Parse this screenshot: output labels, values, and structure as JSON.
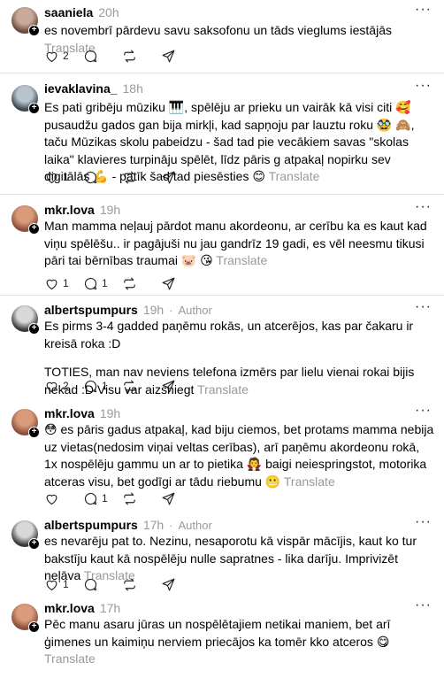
{
  "translate_label": "Translate",
  "author_label": "Author",
  "posts": [
    {
      "username": "saaniela",
      "time": "20h",
      "is_author": false,
      "paragraphs": [
        "es novembrī pārdevu savu saksofonu un tāds vieglums iestājās"
      ],
      "likes": "2",
      "replies": ""
    },
    {
      "username": "ievaklavina_",
      "time": "18h",
      "is_author": false,
      "paragraphs": [
        "Es pati gribēju mūziku 🎹, spēlēju ar prieku un vairāk kā visi citi 🥰 pusaudžu gados gan bija mirkļi, kad sapņoju par lauztu roku 🥸 🙈, taču Mūzikas skolu pabeidzu - šad tad pie vecākiem savas \"skolas laika\" klavieres turpināju spēlēt, līdz pāris g atpakaļ nopirku sev digitālās 💪 - patīk šad tad piesēsties 😊"
      ],
      "likes": "1",
      "replies": ""
    },
    {
      "username": "mkr.lova",
      "time": "19h",
      "is_author": false,
      "paragraphs": [
        "Man mamma neļauj pārdot manu akordeonu, ar cerību ka es kaut kad viņu spēlēšu.. ir pagājuši nu jau gandrīz 19 gadi, es vēl neesmu tikusi pāri tai bērnības traumai 🐷 😘"
      ],
      "likes": "1",
      "replies": "1"
    },
    {
      "username": "albertspumpurs",
      "time": "19h",
      "is_author": true,
      "paragraphs": [
        "Es pirms 3-4 gadded paņēmu rokās, un atcerējos, kas par čakaru ir kreisā roka :D",
        "TOTIES, man nav neviens telefona izmērs par lielu vienai rokai bijis nekad :D Visu var aizsniegt"
      ],
      "likes": "2",
      "replies": "1"
    },
    {
      "username": "mkr.lova",
      "time": "19h",
      "is_author": false,
      "paragraphs": [
        "😳 es pāris gadus atpakaļ, kad biju ciemos, bet protams mamma nebija uz vietas(nedosim viņai veltas cerības), arī paņēmu akordeonu rokā, 1x nospēlēju gammu un ar to pietika 🧛 baigi neiespringstot, motorika atceras visu, bet godīgi ar tādu riebumu 😬"
      ],
      "likes": "",
      "replies": "1"
    },
    {
      "username": "albertspumpurs",
      "time": "17h",
      "is_author": true,
      "paragraphs": [
        "es nevarēju pat to. Nezinu, nesaporotu kā vispār mācījis, kaut ko tur bakstīju kaut kā nospēlēju nulle sapratnes - lika darīju. Imprivizēt neļāva"
      ],
      "likes": "1",
      "replies": ""
    },
    {
      "username": "mkr.lova",
      "time": "17h",
      "is_author": false,
      "paragraphs": [
        "Pēc manu asaru jūras un nospēlētajiem netikai maniem, bet arī ģimenes un kaimiņu nerviem priecājos ka tomēr kko atceros 😋"
      ],
      "likes": "",
      "replies": ""
    }
  ],
  "colors": {
    "muted": "#999999",
    "divider": "#e2e2e2",
    "text": "#000000"
  },
  "icons": {
    "like": "heart-icon",
    "reply": "comment-icon",
    "repost": "repost-icon",
    "share": "send-icon",
    "more": "ellipsis-icon",
    "follow": "plus-icon"
  }
}
